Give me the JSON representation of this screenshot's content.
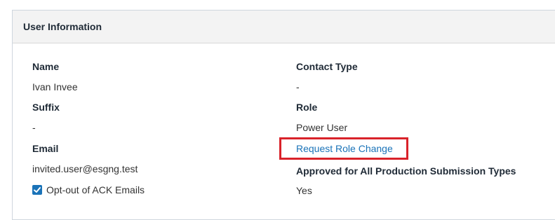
{
  "panel": {
    "title": "User Information"
  },
  "fields": {
    "name_label": "Name",
    "name_value": "Ivan Invee",
    "suffix_label": "Suffix",
    "suffix_value": "-",
    "email_label": "Email",
    "email_value": "invited.user@esgng.test",
    "contact_type_label": "Contact Type",
    "contact_type_value": "-",
    "role_label": "Role",
    "role_value": "Power User",
    "approved_label": "Approved for All Production Submission Types",
    "approved_value": "Yes"
  },
  "actions": {
    "request_role_change": "Request Role Change"
  },
  "opt_out": {
    "label": "Opt-out of ACK Emails",
    "checked": true
  },
  "colors": {
    "link": "#1a73b8",
    "highlight_border": "#d9222a",
    "checkbox": "#1a73b8",
    "header_bg": "#f3f3f3"
  }
}
